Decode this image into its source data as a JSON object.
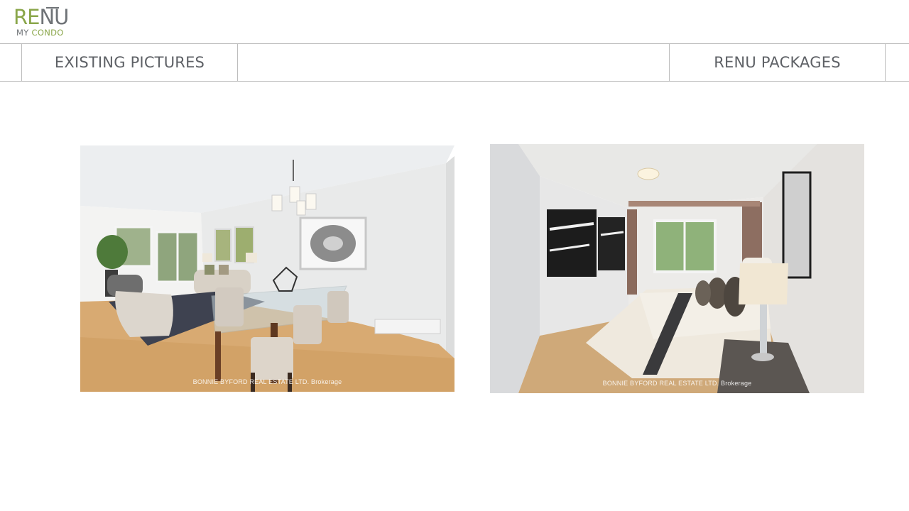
{
  "logo": {
    "re": "RE",
    "nu": "NU",
    "my": "MY",
    "condo": "CONDO"
  },
  "nav": {
    "tabs": [
      {
        "label": "EXISTING PICTURES"
      },
      {
        "label": "RENU PACKAGES"
      }
    ]
  },
  "photos": [
    {
      "subject": "dining-living-room",
      "watermark": "BONNIE BYFORD REAL ESTATE LTD. Brokerage"
    },
    {
      "subject": "bedroom",
      "watermark": "BONNIE BYFORD REAL ESTATE LTD. Brokerage"
    }
  ],
  "colors": {
    "brand_green": "#8aa64a",
    "brand_gray": "#6f7377",
    "nav_text": "#5e6166",
    "border": "#bdbdbd"
  }
}
